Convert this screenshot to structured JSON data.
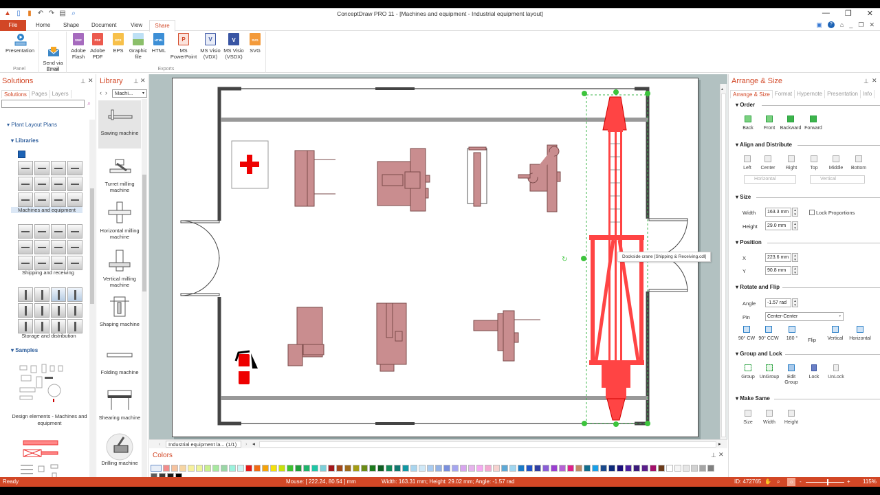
{
  "app": {
    "title": "ConceptDraw PRO 11 - [Machines and equipment - Industrial equipment layout]",
    "window_controls": [
      "—",
      "❐",
      "✕"
    ]
  },
  "tabs": {
    "file": "File",
    "items": [
      "Home",
      "Shape",
      "Document",
      "View",
      "Share"
    ],
    "active": "Share"
  },
  "ribbon": {
    "groups": [
      {
        "label": "Panel",
        "buttons": [
          {
            "label": "Presentation",
            "icon": "presentation-icon"
          }
        ]
      },
      {
        "label": "Email",
        "buttons": [
          {
            "label": "Send via\nEmail",
            "icon": "email-icon"
          }
        ]
      },
      {
        "label": "Exports",
        "buttons": [
          {
            "label": "Adobe\nFlash",
            "icon": "swf-file-icon",
            "tag": "SWF",
            "color": "#9b59b6"
          },
          {
            "label": "Adobe\nPDF",
            "icon": "pdf-file-icon",
            "tag": "PDF",
            "color": "#e74c3c"
          },
          {
            "label": "EPS",
            "icon": "eps-file-icon",
            "tag": "EPS",
            "color": "#f5b52e"
          },
          {
            "label": "Graphic\nfile",
            "icon": "image-file-icon",
            "tag": "",
            "color": "#8bbf6a"
          },
          {
            "label": "HTML",
            "icon": "html-file-icon",
            "tag": "HTML",
            "color": "#2c82c9"
          },
          {
            "label": "MS\nPowerPoint",
            "icon": "powerpoint-icon",
            "tag": "P",
            "color": "#d24726"
          },
          {
            "label": "MS Visio\n(VDX)",
            "icon": "visio-vdx-icon",
            "tag": "V",
            "color": "#3955a3"
          },
          {
            "label": "MS Visio\n(VSDX)",
            "icon": "visio-vsdx-icon",
            "tag": "V",
            "color": "#3955a3"
          },
          {
            "label": "SVG",
            "icon": "svg-file-icon",
            "tag": "SVG",
            "color": "#f08a24"
          }
        ]
      }
    ]
  },
  "solutions_panel": {
    "title": "Solutions",
    "subtabs": [
      "Solutions",
      "Pages",
      "Layers"
    ],
    "active_subtab": "Solutions",
    "search_value": "",
    "tree": {
      "root": "Plant Layout Plans",
      "libraries_header": "Libraries",
      "libraries": [
        "Machines and equipment",
        "Shipping and receiving",
        "Storage and distribution"
      ],
      "selected_library": "Machines and equipment",
      "samples_header": "Samples",
      "samples": [
        "Design elements - Machines and equipment"
      ]
    }
  },
  "library_panel": {
    "title": "Library",
    "dropdown": "Machi...",
    "items": [
      "Sawing machine",
      "Turret milling machine",
      "Horizontal milling machine",
      "Vertical milling machine",
      "Shaping machine",
      "Folding machine",
      "Shearing machine",
      "Drilling machine"
    ],
    "selected": "Sawing machine"
  },
  "canvas": {
    "tooltip": "Dockside crane [Shipping & Receiving.cdl]",
    "selected_shape": "Dockside crane",
    "page_selector": "Industrial equipment la... (1/1)"
  },
  "colors_panel": {
    "title": "Colors",
    "swatches": [
      "#f28c8c",
      "#f6c29e",
      "#f7d5a3",
      "#f6f09c",
      "#eef59a",
      "#c9f08e",
      "#a7e8a0",
      "#9ad6a6",
      "#9cf2dd",
      "#cdf5f5",
      "#e61919",
      "#f06a14",
      "#f5a30a",
      "#f5e00a",
      "#c8e10a",
      "#3ec232",
      "#1f9e3a",
      "#1fb36b",
      "#1fc6a6",
      "#7ccfd9",
      "#a3161b",
      "#a3481a",
      "#9e6a1c",
      "#a49c14",
      "#6b8c16",
      "#1d7a1d",
      "#0f5e22",
      "#138a58",
      "#11786f",
      "#1198a4",
      "#a9d5ee",
      "#cfe8f7",
      "#a9ccf1",
      "#94b3e6",
      "#7a8fdc",
      "#a6a6ef",
      "#d8a6ef",
      "#e6b4ec",
      "#f6a9f1",
      "#f3a9d1",
      "#f6d2cf",
      "#5ea9d6",
      "#9fd6f0",
      "#1a7bc8",
      "#1f54c8",
      "#2f3ea3",
      "#8a5fd6",
      "#9a3fd0",
      "#b662d4",
      "#e0208a",
      "#c08a66",
      "#116d8c",
      "#1aa0e8",
      "#1a4a8c",
      "#0c2a7a",
      "#1a0f7a",
      "#4a1fa0",
      "#3a1a7a",
      "#5a1f8a",
      "#a3106a",
      "#6b3a1a",
      "#ffffff",
      "#f5f5f5",
      "#e6e6e6",
      "#d1d1d1",
      "#a6a6a6",
      "#808080",
      "#5e5e5e",
      "#3b3b3b",
      "#1a1a1a",
      "#000000"
    ]
  },
  "arrange_panel": {
    "title": "Arrange & Size",
    "subtabs": [
      "Arrange & Size",
      "Format",
      "Hypernote",
      "Presentation",
      "Info"
    ],
    "active_subtab": "Arrange & Size",
    "order": {
      "header": "Order",
      "buttons": [
        "Back",
        "Front",
        "Backward",
        "Forward"
      ]
    },
    "align": {
      "header": "Align and Distribute",
      "buttons": [
        "Left",
        "Center",
        "Right",
        "Top",
        "Middle",
        "Bottom"
      ],
      "horizontal": "Horizontal",
      "vertical": "Vertical"
    },
    "size": {
      "header": "Size",
      "width_label": "Width",
      "width": "163.3 mm",
      "height_label": "Height",
      "height": "29.0 mm",
      "lock_label": "Lock Proportions",
      "lock_checked": false
    },
    "position": {
      "header": "Position",
      "x_label": "X",
      "x": "223.6 mm",
      "y_label": "Y",
      "y": "90.8 mm"
    },
    "rotate": {
      "header": "Rotate and Flip",
      "angle_label": "Angle",
      "angle": "-1.57 rad",
      "pin_label": "Pin",
      "pin": "Center-Center",
      "buttons": [
        "90° CW",
        "90° CCW",
        "180 °"
      ],
      "flip_label": "Flip",
      "flip_buttons": [
        "Vertical",
        "Horizontal"
      ]
    },
    "group": {
      "header": "Group and Lock",
      "buttons": [
        "Group",
        "UnGroup",
        "Edit\nGroup",
        "Lock",
        "UnLock"
      ]
    },
    "same": {
      "header": "Make Same",
      "buttons": [
        "Size",
        "Width",
        "Height"
      ]
    }
  },
  "status": {
    "ready": "Ready",
    "mouse": "Mouse: [ 222.24, 80.54 ] mm",
    "dims": "Width: 163.31 mm;  Height: 29.02 mm;  Angle: -1.57 rad",
    "id": "ID: 472765",
    "zoom": "115%",
    "zoom_fraction": 0.55
  }
}
